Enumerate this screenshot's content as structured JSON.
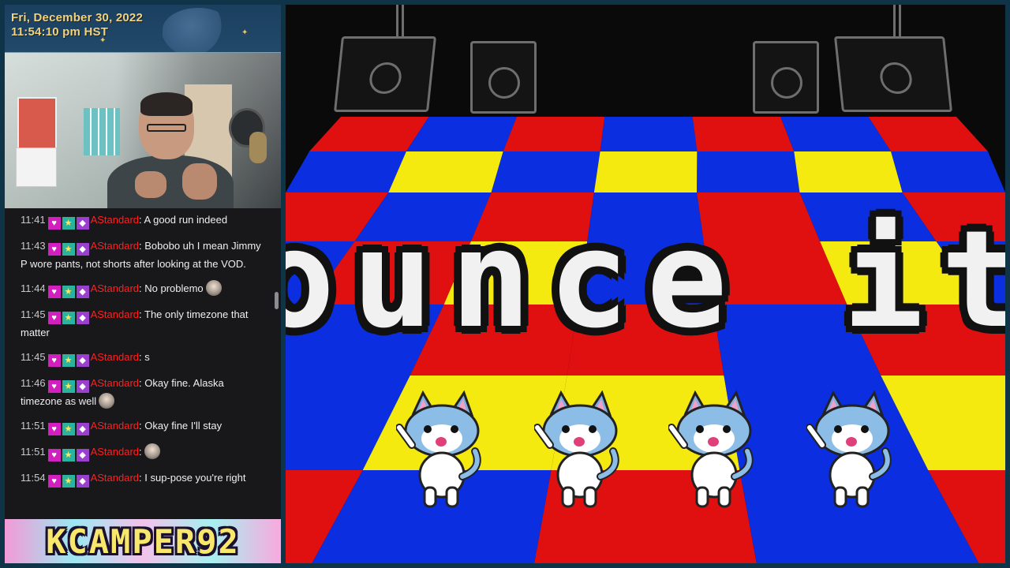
{
  "overlay": {
    "date": "Fri, December 30, 2022",
    "time": "11:54:10 pm HST",
    "channel_banner": "KCAMPER92"
  },
  "chat": {
    "messages": [
      {
        "time": "11:41",
        "user": "AStandard",
        "text": ": A good run indeed",
        "emote": false
      },
      {
        "time": "11:43",
        "user": "AStandard",
        "text": ": Bobobo uh I mean Jimmy P wore pants, not shorts after looking at the VOD.",
        "emote": false
      },
      {
        "time": "11:44",
        "user": "AStandard",
        "text": ": No problemo",
        "emote": true
      },
      {
        "time": "11:45",
        "user": "AStandard",
        "text": ": The only timezone that matter",
        "emote": false
      },
      {
        "time": "11:45",
        "user": "AStandard",
        "text": ": s",
        "emote": false
      },
      {
        "time": "11:46",
        "user": "AStandard",
        "text": ": Okay fine. Alaska timezone as well",
        "emote": true
      },
      {
        "time": "11:51",
        "user": "AStandard",
        "text": ": Okay fine I'll stay",
        "emote": false
      },
      {
        "time": "11:51",
        "user": "AStandard",
        "text": ":",
        "emote": true
      },
      {
        "time": "11:54",
        "user": "AStandard",
        "text": ": I sup-pose you're right",
        "emote": false
      }
    ],
    "badges": [
      "heart-badge",
      "star-badge",
      "gem-badge"
    ],
    "username_color": "#ff2020"
  },
  "game": {
    "banner_text": "ounce it",
    "floor_colors": [
      "#e01010",
      "#0a2ee0",
      "#f5ea10"
    ],
    "cat_count": 4
  }
}
